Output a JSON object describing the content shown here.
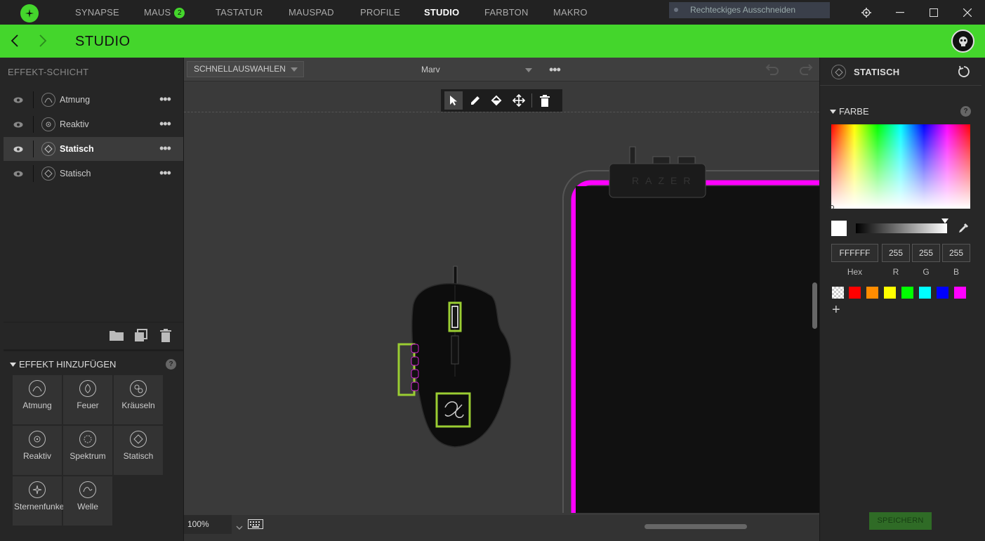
{
  "nav": {
    "items": [
      {
        "label": "SYNAPSE"
      },
      {
        "label": "MAUS",
        "badge": "2"
      },
      {
        "label": "TASTATUR"
      },
      {
        "label": "MAUSPAD"
      },
      {
        "label": "PROFILE"
      },
      {
        "label": "STUDIO",
        "active": true
      },
      {
        "label": "FARBTON"
      },
      {
        "label": "MAKRO"
      }
    ],
    "snip_overlay": "Rechteckiges Ausschneiden"
  },
  "header": {
    "title": "STUDIO",
    "accent": "#44d62c"
  },
  "layers": {
    "title": "EFFEKT-SCHICHT",
    "items": [
      {
        "label": "Atmung",
        "icon": "breathing-icon"
      },
      {
        "label": "Reaktiv",
        "icon": "reactive-icon"
      },
      {
        "label": "Statisch",
        "icon": "static-icon",
        "selected": true
      },
      {
        "label": "Statisch",
        "icon": "static-icon"
      }
    ]
  },
  "add_effect": {
    "title": "EFFEKT HINZUFÜGEN",
    "help": "?",
    "tiles": [
      {
        "label": "Atmung"
      },
      {
        "label": "Feuer"
      },
      {
        "label": "Kräuseln"
      },
      {
        "label": "Reaktiv"
      },
      {
        "label": "Spektrum"
      },
      {
        "label": "Statisch"
      },
      {
        "label": "Sternenfunkeln"
      },
      {
        "label": "Welle"
      }
    ]
  },
  "canvas": {
    "quick_select": "SCHNELLAUSWAHLEN",
    "profile": "Marv",
    "zoom": "100%",
    "mousepad_brand": "RAZER",
    "device_glow": "#ff00ff"
  },
  "color_panel": {
    "title": "STATISCH",
    "section": "FARBE",
    "help": "?",
    "hex": "FFFFFF",
    "r": "255",
    "g": "255",
    "b": "255",
    "labels": {
      "hex": "Hex",
      "r": "R",
      "g": "G",
      "b": "B"
    },
    "presets": [
      "transparent",
      "#ff0000",
      "#ff8c00",
      "#ffff00",
      "#00ff00",
      "#00ffff",
      "#0000ff",
      "#ff00ff"
    ],
    "plus": "+",
    "save": "SPEICHERN"
  }
}
